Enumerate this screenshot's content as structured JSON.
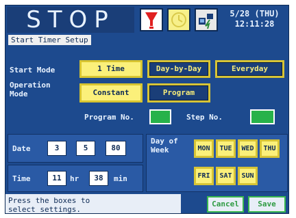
{
  "header": {
    "title": "STOP",
    "date_line1": "5/28 (THU)",
    "date_line2": "12:11:28",
    "icons": [
      "alarm-icon",
      "clock-icon",
      "network-icon"
    ],
    "colors": {
      "screen_bg": "#1d4a8e",
      "active_button": "#fbf07a",
      "green_field": "#27b24a"
    }
  },
  "section": {
    "title": "Start Timer Setup"
  },
  "start_mode": {
    "label": "Start Mode",
    "options": [
      "1 Time",
      "Day-by-Day",
      "Everyday"
    ],
    "selected": "1 Time"
  },
  "operation_mode": {
    "label_line1": "Operation",
    "label_line2": "Mode",
    "options": [
      "Constant",
      "Program"
    ],
    "selected": "Constant"
  },
  "program_no": {
    "label": "Program No."
  },
  "step_no": {
    "label": "Step No."
  },
  "date": {
    "label": "Date",
    "month": "3",
    "day": "5",
    "year": "80"
  },
  "time": {
    "label": "Time",
    "hour": "11",
    "hour_unit": "hr",
    "minute": "38",
    "minute_unit": "min"
  },
  "day_of_week": {
    "label_line1": "Day of",
    "label_line2": "Week",
    "days": [
      "MON",
      "TUE",
      "WED",
      "THU",
      "FRI",
      "SAT",
      "SUN"
    ]
  },
  "footer": {
    "message_line1": "Press the boxes to",
    "message_line2": "select settings.",
    "cancel_label": "Cancel",
    "save_label": "Save"
  }
}
